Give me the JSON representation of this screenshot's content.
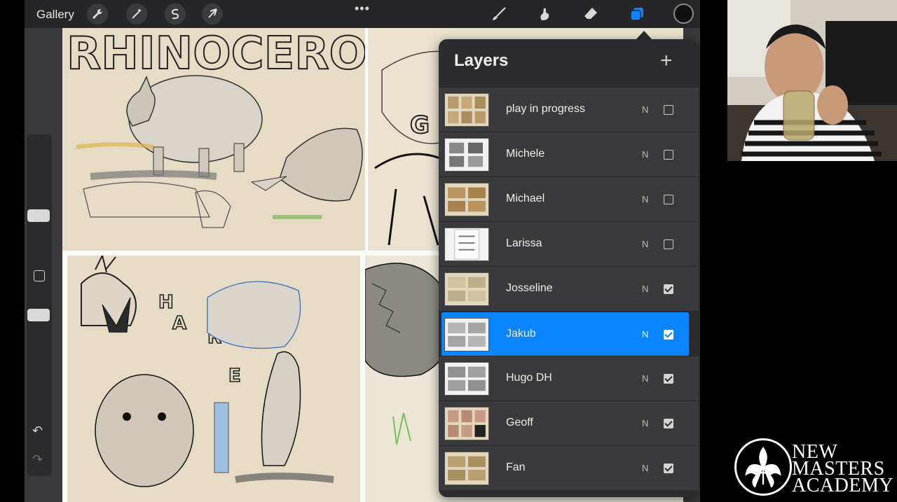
{
  "toolbar": {
    "gallery_label": "Gallery",
    "more_dots": "•••",
    "left_tools": [
      "wrench-icon",
      "magic-wand-icon",
      "selection-icon",
      "arrow-cursor-icon"
    ],
    "right_tools": [
      "brush-icon",
      "smudge-icon",
      "eraser-icon",
      "layers-icon"
    ],
    "active_tool": "layers-icon",
    "current_color": "#111111"
  },
  "sidebar": {
    "undo": "↶",
    "redo": "↷"
  },
  "canvas": {
    "lettering_top": "RHINOCEROS",
    "lettering_hare": [
      "H",
      "A",
      "R",
      "E"
    ]
  },
  "layers_panel": {
    "title": "Layers",
    "add_symbol": "+",
    "accent_color": "#0a84ff",
    "layers": [
      {
        "name": "play in progress",
        "blend": "N",
        "visible": false,
        "active": false
      },
      {
        "name": "Michele",
        "blend": "N",
        "visible": false,
        "active": false
      },
      {
        "name": "Michael",
        "blend": "N",
        "visible": false,
        "active": false
      },
      {
        "name": "Larissa",
        "blend": "N",
        "visible": false,
        "active": false
      },
      {
        "name": "Josseline",
        "blend": "N",
        "visible": true,
        "active": false
      },
      {
        "name": "Jakub",
        "blend": "N",
        "visible": true,
        "active": true
      },
      {
        "name": "Hugo DH",
        "blend": "N",
        "visible": true,
        "active": false
      },
      {
        "name": "Geoff",
        "blend": "N",
        "visible": true,
        "active": false
      },
      {
        "name": "Fan",
        "blend": "N",
        "visible": true,
        "active": false
      }
    ]
  },
  "logo": {
    "line1": "NEW",
    "line2": "MASTERS",
    "line3": "ACADEMY"
  }
}
